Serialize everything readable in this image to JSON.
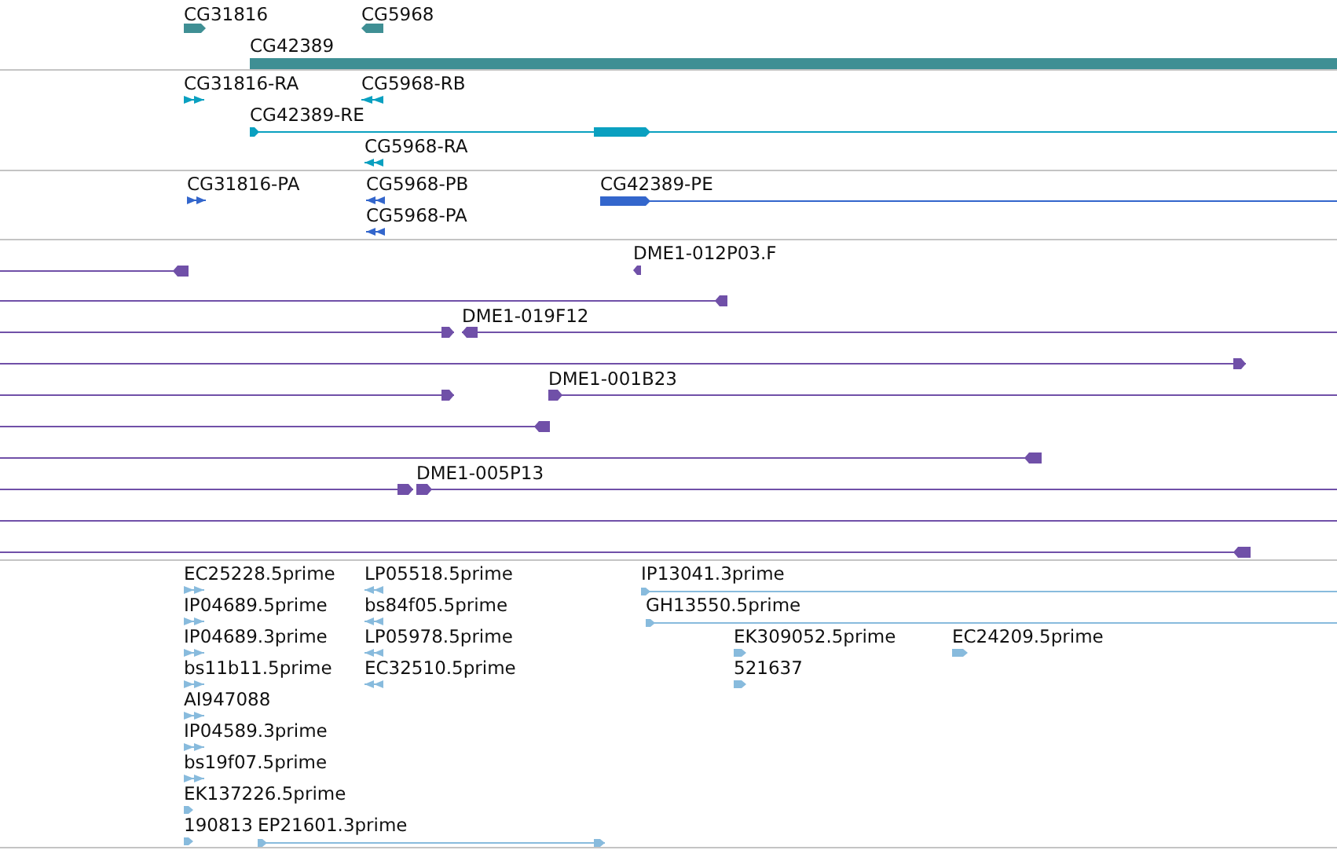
{
  "tracks": [
    {
      "color": "#3f8f94",
      "features": [
        {
          "label": "CG31816",
          "reverse": false
        },
        {
          "label": "CG5968",
          "reverse": true
        },
        {
          "label": "CG42389"
        }
      ]
    },
    {
      "color": "#0aa0c0",
      "features": [
        {
          "label": "CG31816-RA",
          "reverse": false
        },
        {
          "label": "CG5968-RB",
          "reverse": true
        },
        {
          "label": "CG42389-RE",
          "reverse": false
        },
        {
          "label": "CG5968-RA",
          "reverse": true
        }
      ]
    },
    {
      "color": "#3366cc",
      "features": [
        {
          "label": "CG31816-PA",
          "reverse": false
        },
        {
          "label": "CG5968-PB",
          "reverse": true
        },
        {
          "label": "CG42389-PE",
          "reverse": false
        },
        {
          "label": "CG5968-PA",
          "reverse": true
        }
      ]
    },
    {
      "color": "#7050a8",
      "features": [
        {
          "reverse": true
        },
        {
          "label": "DME1-012P03.F",
          "reverse": true
        },
        {
          "reverse": true
        },
        {
          "reverse": false
        },
        {
          "label": "DME1-019F12",
          "reverse": true
        },
        {
          "reverse": false
        },
        {
          "reverse": false
        },
        {
          "label": "DME1-001B23",
          "reverse": false
        },
        {
          "reverse": true
        },
        {
          "reverse": true
        },
        {
          "reverse": false
        },
        {
          "label": "DME1-005P13",
          "reverse": false
        },
        {
          "reverse": true
        }
      ]
    },
    {
      "color": "#88bbdd",
      "features": [
        {
          "label": "EC25228.5prime",
          "reverse": false
        },
        {
          "label": "LP05518.5prime",
          "reverse": true
        },
        {
          "label": "IP13041.3prime",
          "reverse": false
        },
        {
          "label": "IP04689.5prime",
          "reverse": false
        },
        {
          "label": "bs84f05.5prime",
          "reverse": true
        },
        {
          "label": "GH13550.5prime",
          "reverse": false
        },
        {
          "label": "IP04689.3prime",
          "reverse": false
        },
        {
          "label": "LP05978.5prime",
          "reverse": true
        },
        {
          "label": "EK309052.5prime",
          "reverse": false
        },
        {
          "label": "EC24209.5prime",
          "reverse": false
        },
        {
          "label": "bs11b11.5prime",
          "reverse": false
        },
        {
          "label": "EC32510.5prime",
          "reverse": true
        },
        {
          "label": "521637",
          "reverse": false
        },
        {
          "label": "AI947088",
          "reverse": false
        },
        {
          "label": "IP04589.3prime",
          "reverse": false
        },
        {
          "label": "bs19f07.5prime",
          "reverse": false
        },
        {
          "label": "EK137226.5prime",
          "reverse": false
        },
        {
          "label": "190813",
          "reverse": false
        },
        {
          "label": "EP21601.3prime",
          "reverse": false
        }
      ]
    }
  ]
}
